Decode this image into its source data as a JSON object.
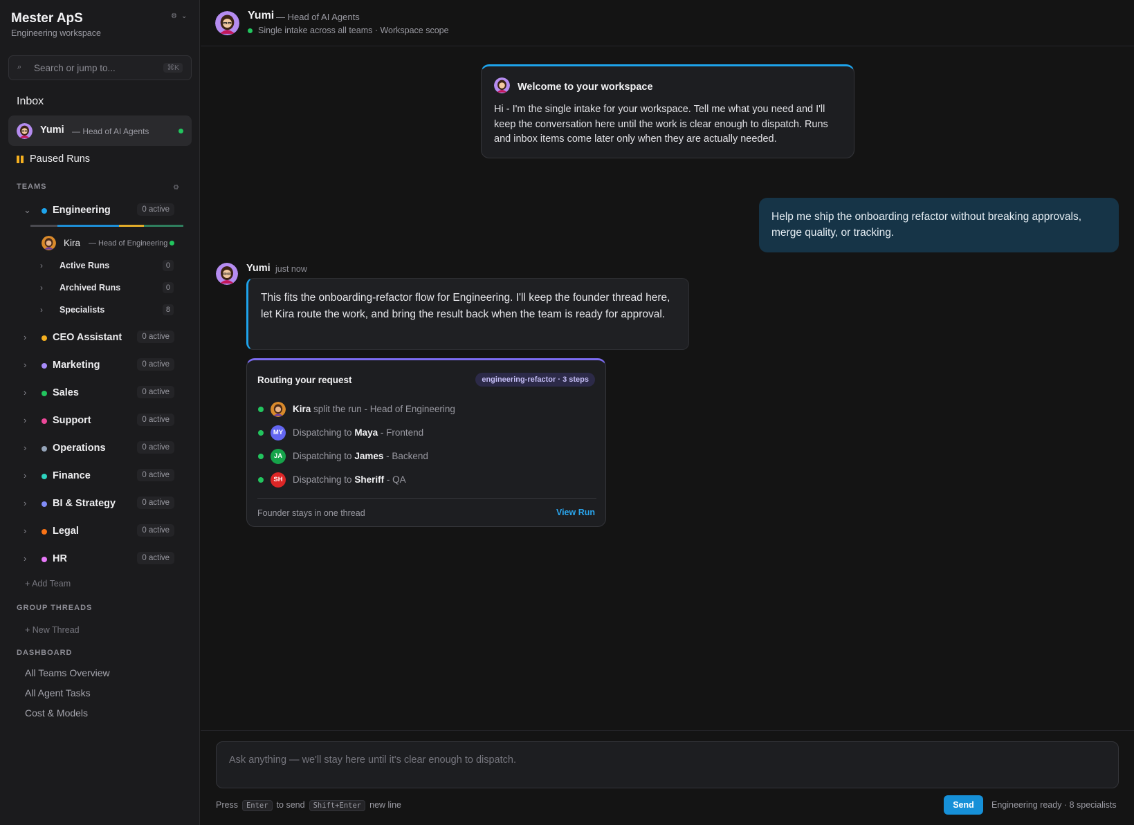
{
  "workspace": {
    "name": "Mester ApS",
    "subtitle": "Engineering workspace"
  },
  "search": {
    "placeholder": "Search or jump to...",
    "shortcut": "⌘K"
  },
  "inbox": {
    "label": "Inbox",
    "agent": {
      "name": "Yumi",
      "role": "— Head of AI Agents",
      "status_color": "#22c55e"
    },
    "paused_label": "Paused Runs"
  },
  "teams_section": {
    "heading": "TEAMS",
    "teams": [
      {
        "name": "Engineering",
        "badge": "0 active",
        "color": "#1ea4ec",
        "expanded": true
      },
      {
        "name": "CEO Assistant",
        "badge": "0 active",
        "color": "#f5b020"
      },
      {
        "name": "Marketing",
        "badge": "0 active",
        "color": "#a78bfa"
      },
      {
        "name": "Sales",
        "badge": "0 active",
        "color": "#22c55e"
      },
      {
        "name": "Support",
        "badge": "0 active",
        "color": "#ec4899"
      },
      {
        "name": "Operations",
        "badge": "0 active",
        "color": "#94a3b8"
      },
      {
        "name": "Finance",
        "badge": "0 active",
        "color": "#2dd4bf"
      },
      {
        "name": "BI & Strategy",
        "badge": "0 active",
        "color": "#818cf8"
      },
      {
        "name": "Legal",
        "badge": "0 active",
        "color": "#f97316"
      },
      {
        "name": "HR",
        "badge": "0 active",
        "color": "#e879f9"
      }
    ],
    "engineering": {
      "lead_name": "Kira",
      "lead_role": "— Head of Engineering",
      "items": [
        {
          "label": "Active Runs",
          "count": "0"
        },
        {
          "label": "Archived Runs",
          "count": "0"
        },
        {
          "label": "Specialists",
          "count": "8"
        }
      ]
    },
    "add_team": "+ Add Team"
  },
  "group_threads": {
    "heading": "GROUP THREADS",
    "new_thread": "+ New Thread"
  },
  "dashboard": {
    "heading": "DASHBOARD",
    "items": [
      "All Teams Overview",
      "All Agent Tasks",
      "Cost & Models"
    ]
  },
  "header": {
    "name": "Yumi",
    "role": "— Head of AI Agents",
    "status": "Single intake across all teams · Workspace scope"
  },
  "welcome": {
    "title": "Welcome to your workspace",
    "body": "Hi - I'm the single intake for your workspace. Tell me what you need and I'll keep the conversation here until the work is clear enough to dispatch. Runs and inbox items come later only when they are actually needed."
  },
  "user_message": "Help me ship the onboarding refactor without breaking approvals, merge quality, or tracking.",
  "agent_message": {
    "name": "Yumi",
    "time": "just now",
    "text": "This fits the onboarding-refactor flow for Engineering. I'll keep the founder thread here, let Kira route the work, and bring the result back when the team is ready for approval."
  },
  "routing": {
    "title": "Routing your request",
    "tag": "engineering-refactor · 3 steps",
    "steps": [
      {
        "initials": "",
        "prefix": "",
        "name": "Kira",
        "suffix": " split the run - Head of Engineering",
        "color": ""
      },
      {
        "initials": "MY",
        "prefix": "Dispatching to ",
        "name": "Maya",
        "suffix": " - Frontend",
        "color": "#6366f1"
      },
      {
        "initials": "JA",
        "prefix": "Dispatching to ",
        "name": "James",
        "suffix": " - Backend",
        "color": "#16a34a"
      },
      {
        "initials": "SH",
        "prefix": "Dispatching to ",
        "name": "Sheriff",
        "suffix": " - QA",
        "color": "#dc2626"
      }
    ],
    "footer": "Founder stays in one thread",
    "link": "View Run"
  },
  "composer": {
    "placeholder": "Ask anything — we'll stay here until it's clear enough to dispatch.",
    "hint_press": "Press",
    "hint_enter": "Enter",
    "hint_send": "to send",
    "hint_shift": "Shift+Enter",
    "hint_newline": "new line",
    "send_label": "Send",
    "status": "Engineering ready · 8 specialists"
  }
}
